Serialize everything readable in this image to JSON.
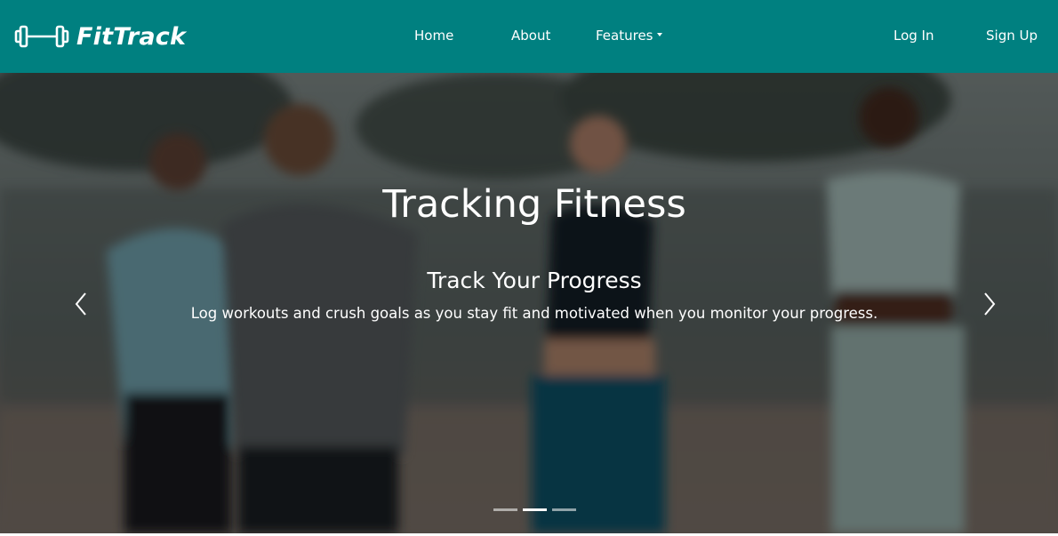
{
  "brand": {
    "name": "FitTrack",
    "icon": "dumbbell-icon"
  },
  "nav": {
    "home": "Home",
    "about": "About",
    "features": "Features",
    "login": "Log In",
    "signup": "Sign Up"
  },
  "hero": {
    "title": "Tracking Fitness",
    "slide_heading": "Track Your Progress",
    "slide_text": "Log workouts and crush goals as you stay fit and motivated when you monitor your progress.",
    "prev_icon": "chevron-left-icon",
    "next_icon": "chevron-right-icon",
    "slide_count": 3,
    "active_slide": 2
  },
  "colors": {
    "navbar_bg": "#008080",
    "text": "#ffffff"
  }
}
